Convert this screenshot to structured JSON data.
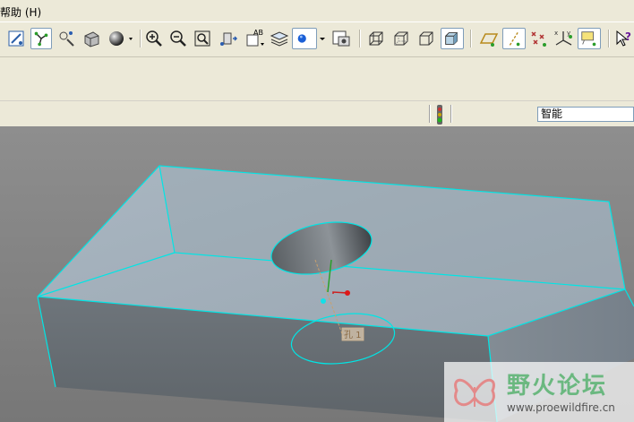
{
  "menu": {
    "help_label": "帮助 (H)"
  },
  "toolbar": {
    "icons": [
      "sketcher-display-icon",
      "datum-axis-toggle-icon",
      "spin-center-icon",
      "wireframe-display-icon",
      "shading-icon",
      "zoom-in-icon",
      "zoom-out-icon",
      "refit-icon",
      "reorient-icon",
      "saved-views-icon",
      "layers-icon",
      "appearance-icon",
      "named-view-manager-icon",
      "wireframe-box-icon",
      "hidden-line-box-icon",
      "no-hidden-box-icon",
      "shaded-box-icon",
      "datum-planes-icon",
      "datum-axes-icon",
      "datum-points-icon",
      "coordinate-systems-icon",
      "annotation-display-icon",
      "whats-this-help-icon"
    ]
  },
  "status": {
    "filter_value": "智能"
  },
  "viewport": {
    "dimension_label": "孔 1"
  },
  "watermark": {
    "title": "野火论坛",
    "url": "www.proewildfire.cn"
  },
  "colors": {
    "edge_highlight": "#00e5e5",
    "toolbar_bg": "#ece9d8",
    "viewport_bg": "#808080"
  }
}
